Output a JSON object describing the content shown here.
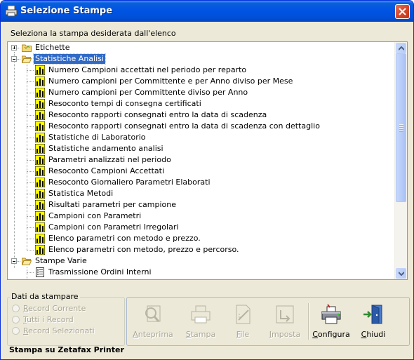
{
  "window": {
    "title": "Selezione Stampe"
  },
  "prompt": "Seleziona la stampa desiderata dall'elenco",
  "tree": {
    "etichette": "Etichette",
    "statistiche": "Statistiche Analisi",
    "stat_items": [
      "Numero Campioni accettati nel periodo per reparto",
      "Numero campioni per Committente e per Anno diviso per Mese",
      "Numero campioni per Committente diviso per Anno",
      "Resoconto tempi di consegna certificati",
      "Resoconto rapporti consegnati entro la data di scadenza",
      "Resoconto rapporti consegnati entro la data di scadenza con dettaglio",
      "Statistiche di Laboratorio",
      "Statistiche andamento analisi",
      "Parametri analizzati nel periodo",
      "Resoconto Campioni Accettati",
      "Resoconto Giornaliero Parametri Elaborati",
      "Statistica Metodi",
      "Risultati parametri per campione",
      "Campioni con Parametri",
      "Campioni con Parametri Irregolari",
      "Elenco parametri con metodo e prezzo.",
      "Elenco parametri con metodo, prezzo e percorso."
    ],
    "varie": "Stampe Varie",
    "varie_items": [
      "Trasmissione Ordini Interni"
    ]
  },
  "dati": {
    "title": "Dati da stampare",
    "options": [
      "Record Corrente",
      "Tutti i Record",
      "Record Selezionati"
    ]
  },
  "toolbar": {
    "anteprima": "Anteprima",
    "stampa": "Stampa",
    "file": "File",
    "imposta": "Imposta",
    "configura": "Configura",
    "chiudi": "Chiudi"
  },
  "status": "Stampa su Zetafax Printer",
  "colors": {
    "selection": "#316ac5",
    "titlebar": "#0054e3"
  }
}
